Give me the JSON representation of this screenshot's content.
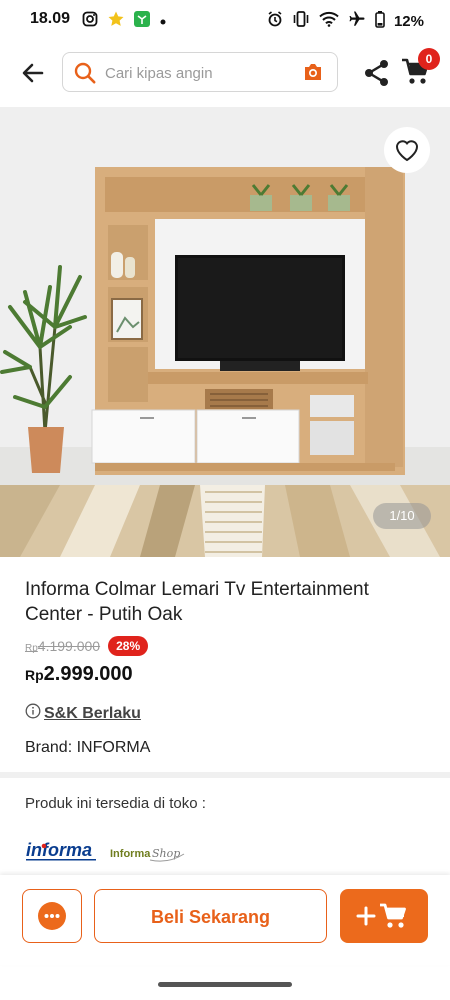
{
  "status_bar": {
    "time": "18.09",
    "battery": "12%",
    "icons": [
      "instagram-icon",
      "star-icon",
      "app-icon",
      "dot-icon",
      "alarm-icon",
      "vibrate-icon",
      "wifi-icon",
      "airplane-icon",
      "battery-icon"
    ]
  },
  "header": {
    "search_placeholder": "Cari kipas angin",
    "cart_count": "0",
    "colors": {
      "accent": "#E8611A",
      "badge": "#E0231C"
    }
  },
  "gallery": {
    "counter": "1/10"
  },
  "product": {
    "title": "Informa Colmar Lemari Tv Entertainment Center - Putih Oak",
    "old_price_currency": "Rp",
    "old_price_value": "4.199.000",
    "discount": "28%",
    "price_currency": "Rp",
    "price_value": "2.999.000",
    "terms": "S&K Berlaku",
    "brand_label": "Brand:",
    "brand_value": "INFORMA"
  },
  "stores": {
    "title": "Produk ini tersedia di toko :",
    "logos": [
      "informa",
      "InformaShop"
    ]
  },
  "actions": {
    "buy_label": "Beli Sekarang"
  }
}
